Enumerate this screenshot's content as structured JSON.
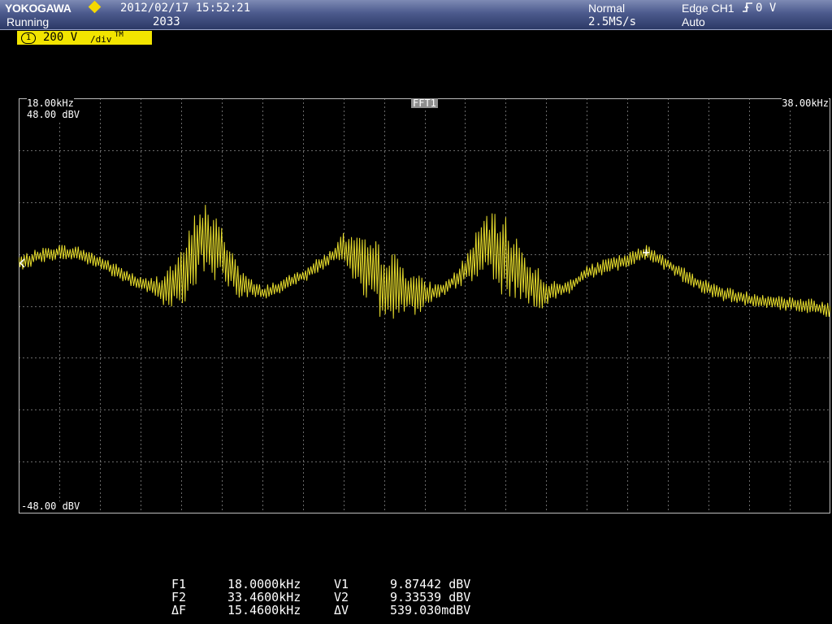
{
  "header": {
    "brand": "YOKOGAWA",
    "run_state": "Running",
    "datetime": "2012/02/17 15:52:21",
    "acquisition_count": "2033",
    "acquisition_mode": "Normal",
    "sample_rate": "2.5MS/s",
    "trigger": "Edge CH1",
    "trigger_level": "0 V",
    "trigger_mode": "Auto"
  },
  "channel": {
    "number": "1",
    "scale": "200 V",
    "unit": "/div",
    "suffix": "TM"
  },
  "plot": {
    "freq_start": "18.00kHz",
    "freq_stop": "38.00kHz",
    "level_top": "48.00 dBV",
    "level_bottom": "-48.00 dBV",
    "math_tag": "FFT1"
  },
  "measurements": {
    "rows": [
      {
        "name1": "F1",
        "value1": "18.0000kHz",
        "name2": "V1",
        "value2": "9.87442 dBV"
      },
      {
        "name1": "F2",
        "value1": "33.4600kHz",
        "name2": "V2",
        "value2": "9.33539 dBV"
      },
      {
        "name1": "ΔF",
        "value1": "15.4600kHz",
        "name2": "ΔV",
        "value2": "539.030mdBV"
      }
    ]
  },
  "colors": {
    "trace": "#e6dc2c",
    "grid": "#6a6a6a",
    "frame": "#bdbdbd",
    "channel_tag": "#f2e400"
  },
  "chart_data": {
    "type": "line",
    "x_range_khz": [
      18.0,
      38.0
    ],
    "y_range_dbv": [
      -48.0,
      48.0
    ],
    "grid": true,
    "series": [
      {
        "x": [
          18,
          18.5,
          19,
          19.5,
          20,
          20.5,
          21,
          21.5,
          22,
          22.5,
          23,
          23.5,
          24,
          24.5,
          25,
          25.5,
          26,
          26.5,
          27,
          27.5,
          28,
          28.5,
          29,
          29.5,
          30,
          30.5,
          31,
          31.5,
          32,
          32.5,
          33,
          33.5,
          34,
          34.5,
          35,
          35.5,
          36,
          36.5,
          37,
          37.5,
          38
        ],
        "y": [
          9.9,
          11.5,
          12.5,
          12.0,
          10.0,
          7.5,
          5.0,
          4.0,
          6.0,
          16.0,
          12.0,
          5.0,
          3.0,
          4.5,
          7.0,
          10.0,
          13.5,
          9.0,
          5.0,
          3.5,
          2.5,
          4.0,
          8.0,
          15.0,
          11.0,
          6.0,
          3.0,
          4.0,
          7.5,
          9.3,
          10.5,
          12.5,
          9.5,
          6.5,
          4.0,
          2.5,
          1.5,
          1.0,
          0.5,
          0.0,
          -1.0
        ]
      }
    ]
  }
}
